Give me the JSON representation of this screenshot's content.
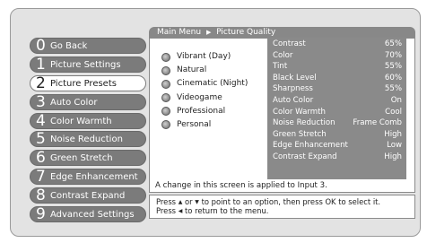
{
  "breadcrumb": {
    "parent": "Main Menu",
    "arrow_icon": "▶",
    "current": "Picture Quality"
  },
  "menu": {
    "items": [
      {
        "num": "0",
        "label": "Go Back",
        "selected": false
      },
      {
        "num": "1",
        "label": "Picture Settings",
        "selected": false
      },
      {
        "num": "2",
        "label": "Picture Presets",
        "selected": true
      },
      {
        "num": "3",
        "label": "Auto Color",
        "selected": false
      },
      {
        "num": "4",
        "label": "Color Warmth",
        "selected": false
      },
      {
        "num": "5",
        "label": "Noise Reduction",
        "selected": false
      },
      {
        "num": "6",
        "label": "Green Stretch",
        "selected": false
      },
      {
        "num": "7",
        "label": "Edge Enhancement",
        "selected": false
      },
      {
        "num": "8",
        "label": "Contrast Expand",
        "selected": false
      },
      {
        "num": "9",
        "label": "Advanced Settings",
        "selected": false
      }
    ]
  },
  "presets": [
    {
      "label": "Vibrant (Day)",
      "selected": false
    },
    {
      "label": "Natural",
      "selected": false
    },
    {
      "label": "Cinematic (Night)",
      "selected": false
    },
    {
      "label": "Videogame",
      "selected": false
    },
    {
      "label": "Professional",
      "selected": false
    },
    {
      "label": "Personal",
      "selected": false
    }
  ],
  "settings": [
    {
      "name": "Contrast",
      "value": "65%"
    },
    {
      "name": "Color",
      "value": "70%"
    },
    {
      "name": "Tint",
      "value": "55%"
    },
    {
      "name": "Black Level",
      "value": "60%"
    },
    {
      "name": "Sharpness",
      "value": "55%"
    },
    {
      "name": "Auto Color",
      "value": "On"
    },
    {
      "name": "Color Warmth",
      "value": "Cool"
    },
    {
      "name": "Noise Reduction",
      "value": "Frame Comb"
    },
    {
      "name": "Green Stretch",
      "value": "High"
    },
    {
      "name": "Edge Enhancement",
      "value": "Low"
    },
    {
      "name": "Contrast Expand",
      "value": "High"
    }
  ],
  "info_note": "A change in this screen is applied to Input 3.",
  "footer": {
    "line1_prefix": "Press",
    "up_icon": "▲",
    "or_text": "or",
    "down_icon": "▼",
    "line1_suffix": "to point to an option, then press OK to select it.",
    "line2_prefix": "Press",
    "left_icon": "◀",
    "line2_suffix": "to return to the menu."
  }
}
